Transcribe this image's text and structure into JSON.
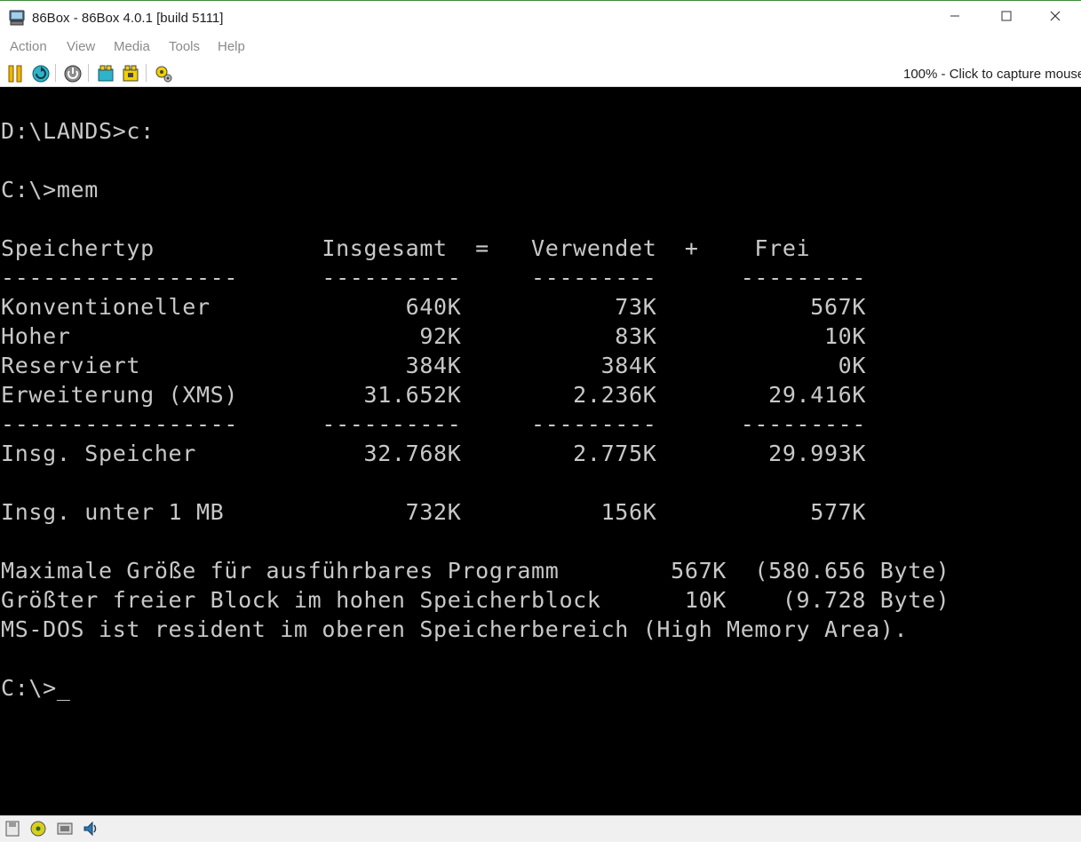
{
  "window": {
    "title": "86Box - 86Box 4.0.1 [build 5111]",
    "app_icon": "86box-computer-icon",
    "controls": [
      "minimize-icon",
      "maximize-icon",
      "close-icon"
    ]
  },
  "menu": {
    "items": [
      "Action",
      "View",
      "Media",
      "Tools",
      "Help"
    ]
  },
  "toolbar": {
    "buttons": [
      "pause-icon",
      "reset-icon",
      "power-icon",
      "ctrl-alt-del-icon",
      "ctrl-alt-esc-icon",
      "settings-icon"
    ],
    "capture_hint": "100% - Click to capture mouse"
  },
  "screen": {
    "lines": [
      "D:\\LANDS>c:",
      "",
      "C:\\>mem",
      "",
      "Speichertyp            Insgesamt  =   Verwendet  +    Frei",
      "-----------------      ----------     ---------      ---------",
      "Konventioneller              640K           73K           567K",
      "Hoher                         92K           83K            10K",
      "Reserviert                   384K          384K             0K",
      "Erweiterung (XMS)         31.652K        2.236K        29.416K",
      "-----------------      ----------     ---------      ---------",
      "Insg. Speicher            32.768K        2.775K        29.993K",
      "",
      "Insg. unter 1 MB             732K          156K           577K",
      "",
      "Maximale Größe für ausführbares Programm        567K  (580.656 Byte)",
      "Größter freier Block im hohen Speicherblock      10K    (9.728 Byte)",
      "MS-DOS ist resident im oberen Speicherbereich (High Memory Area).",
      "",
      "C:\\>"
    ],
    "cursor": "_"
  },
  "statusbar": {
    "icons": [
      "floppy-drive-icon",
      "cdrom-drive-icon",
      "network-icon",
      "sound-icon"
    ]
  },
  "colors": {
    "screen_bg": "#000000",
    "screen_text": "#c8c8c8",
    "window_border": "#3c8a3c"
  }
}
